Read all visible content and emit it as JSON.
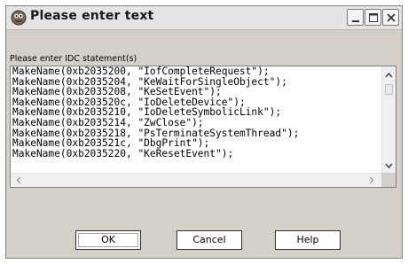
{
  "window": {
    "title": "Please enter text",
    "app_icon": "ida-icon",
    "controls": [
      "minimize-icon",
      "maximize-icon",
      "close-icon"
    ]
  },
  "prompt": {
    "label": "Please enter IDC statement(s)"
  },
  "editor": {
    "lines": [
      "MakeName(0xb2035200, \"IofCompleteRequest\");",
      "MakeName(0xb2035204, \"KeWaitForSingleObject\");",
      "MakeName(0xb2035208, \"KeSetEvent\");",
      "MakeName(0xb203520c, \"IoDeleteDevice\");",
      "MakeName(0xb2035210, \"IoDeleteSymbolicLink\");",
      "MakeName(0xb2035214, \"ZwClose\");",
      "MakeName(0xb2035218, \"PsTerminateSystemThread\");",
      "MakeName(0xb203521c, \"DbgPrint\");",
      "MakeName(0xb2035220, \"KeResetEvent\");"
    ]
  },
  "buttons": {
    "ok": "OK",
    "cancel": "Cancel",
    "help": "Help"
  },
  "colors": {
    "dialog_bg": "#d4d0c8",
    "titlebar_bg": "#e4e4e4",
    "editor_bg": "#ffffff"
  }
}
